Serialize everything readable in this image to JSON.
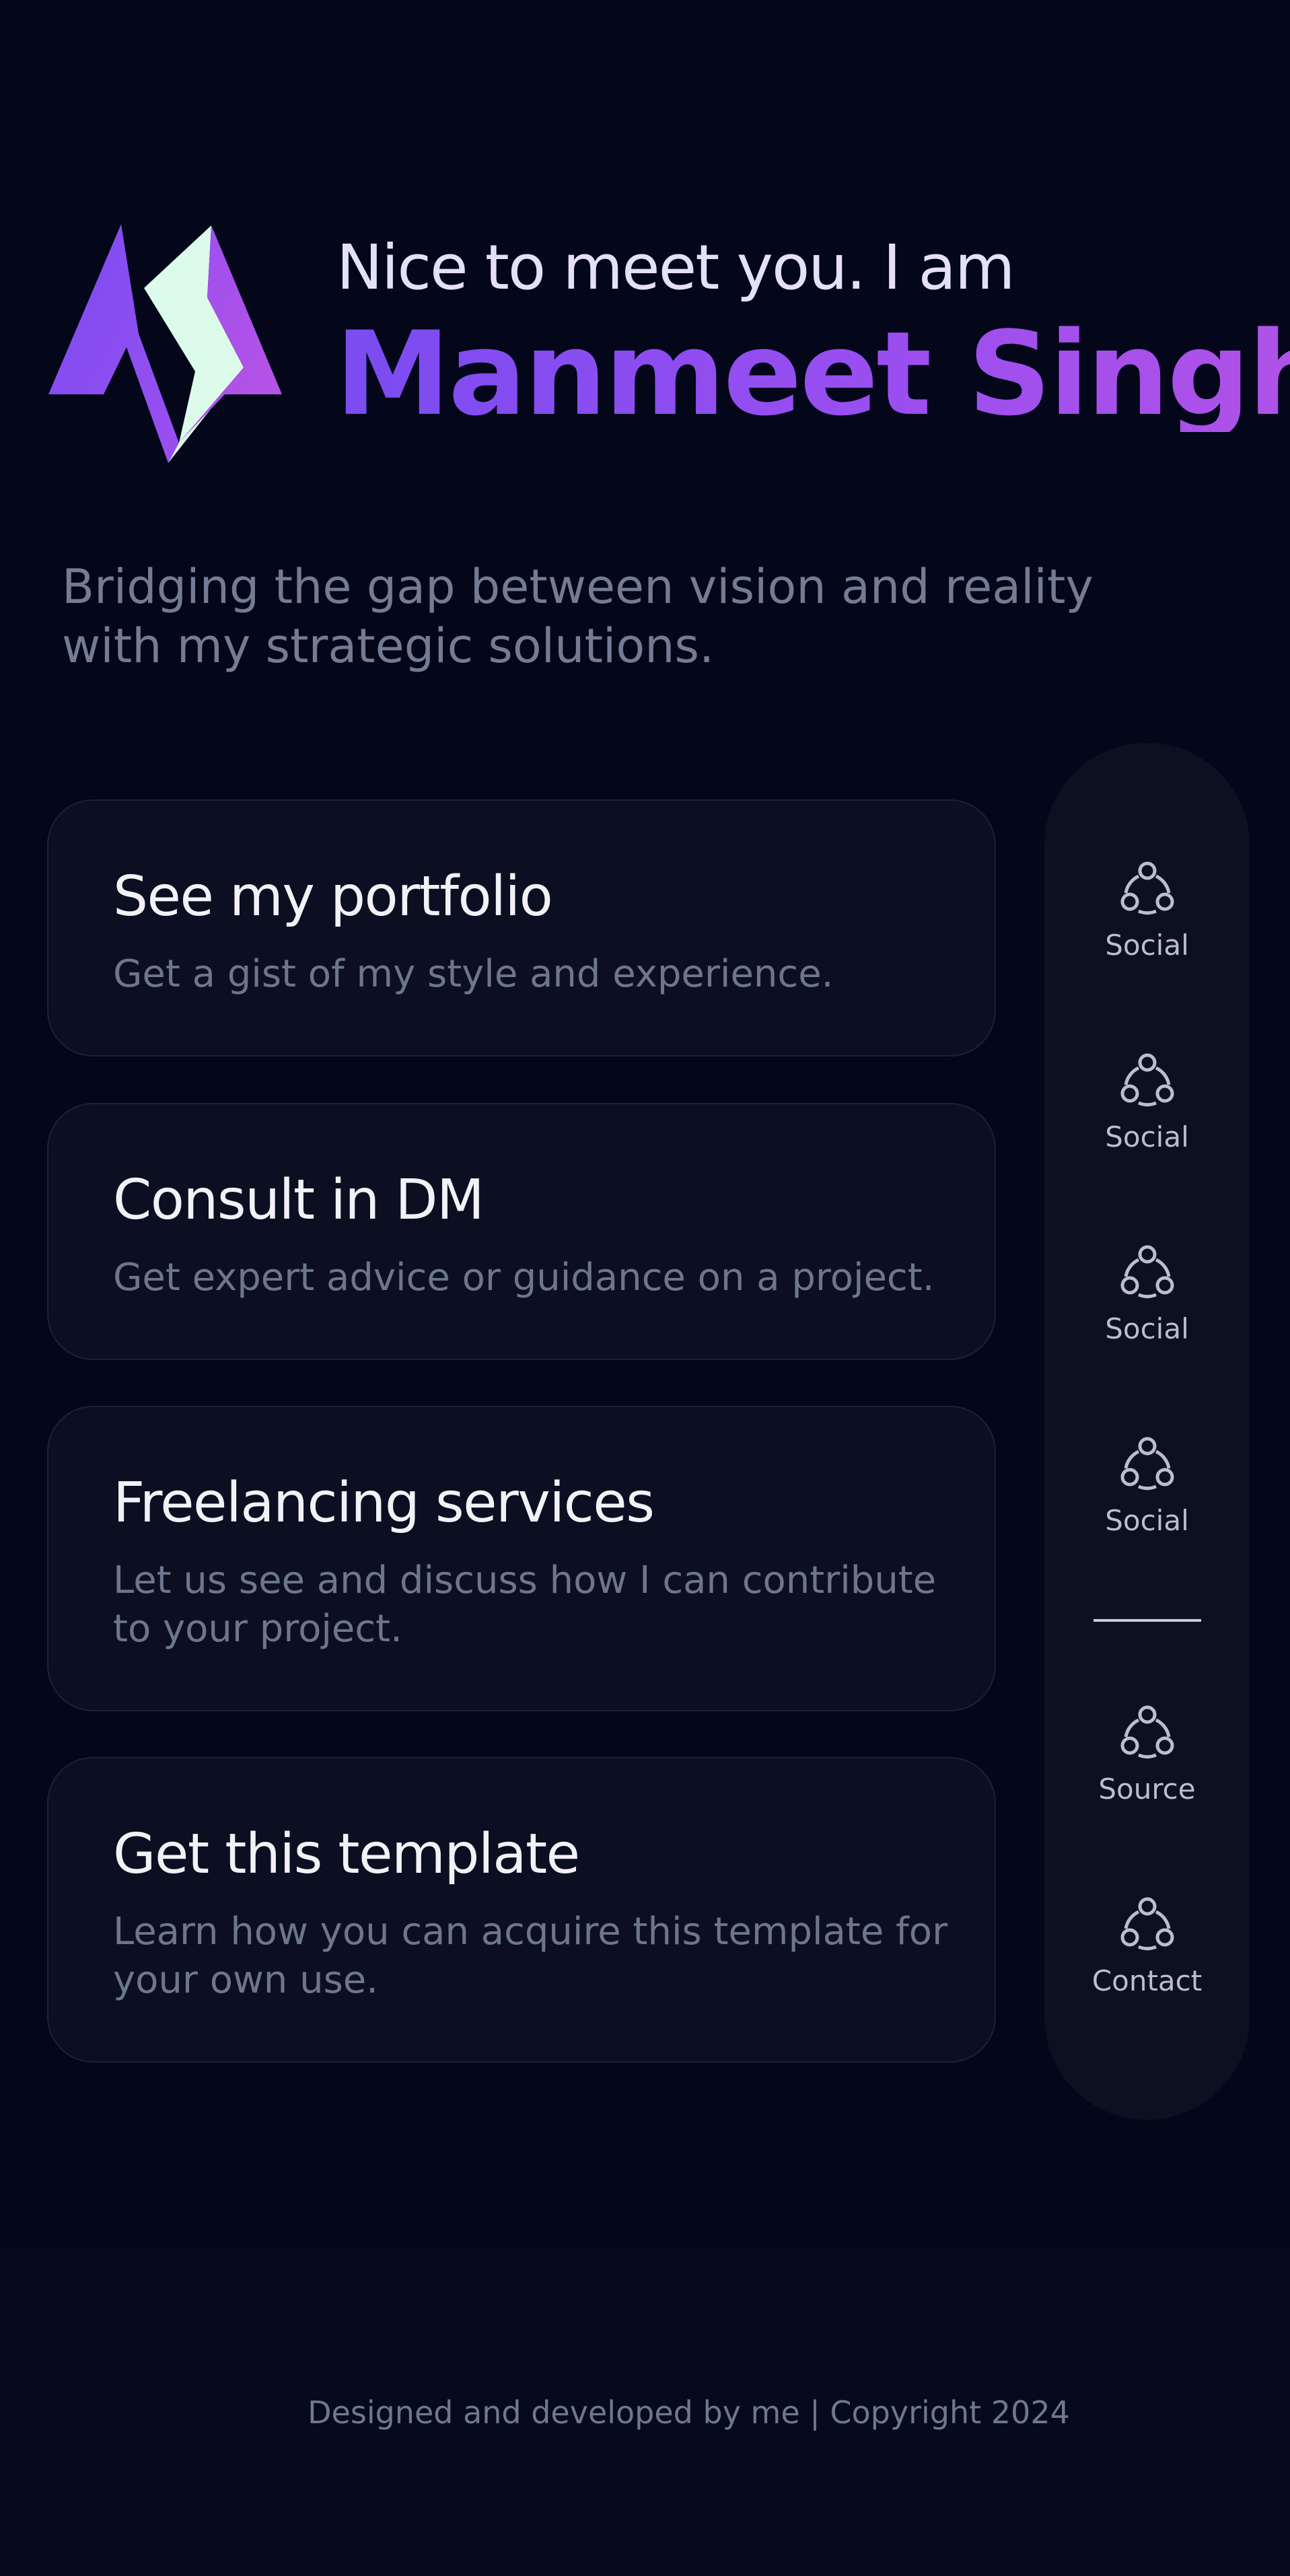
{
  "hero": {
    "greeting": "Nice to meet you. I am",
    "name": "Manmeet Singh",
    "tagline": "Bridging the gap between vision and reality with my strategic solutions."
  },
  "cards": [
    {
      "title": "See my portfolio",
      "description": "Get a gist of my style and experience."
    },
    {
      "title": "Consult in DM",
      "description": "Get expert advice or guidance on a project."
    },
    {
      "title": "Freelancing services",
      "description": "Let us see and discuss how I can contribute to your project."
    },
    {
      "title": "Get this template",
      "description": "Learn how you can acquire this template for your own use."
    }
  ],
  "sidebar": {
    "items": [
      {
        "label": "Social",
        "icon": "share-nodes-icon"
      },
      {
        "label": "Social",
        "icon": "share-nodes-icon"
      },
      {
        "label": "Social",
        "icon": "share-nodes-icon"
      },
      {
        "label": "Social",
        "icon": "share-nodes-icon"
      },
      {
        "label": "Source",
        "icon": "share-nodes-icon"
      },
      {
        "label": "Contact",
        "icon": "share-nodes-icon"
      }
    ]
  },
  "footer": {
    "text": "Designed and developed by me | Copyright 2024"
  },
  "colors": {
    "background": "#04061a",
    "card": "#0b0f21",
    "accent_start": "#7a4cf0",
    "accent_end": "#b252e6",
    "logo_light": "#dcfbea"
  }
}
